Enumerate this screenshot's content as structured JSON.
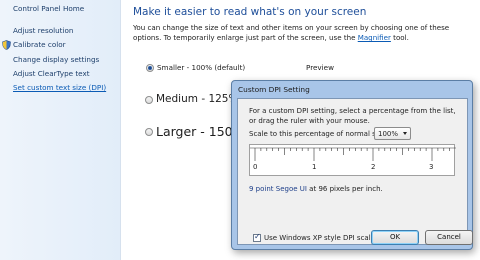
{
  "sidebar": {
    "home": "Control Panel Home",
    "links": [
      "Adjust resolution",
      "Calibrate color",
      "Change display settings",
      "Adjust ClearType text",
      "Set custom text size (DPI)"
    ]
  },
  "main": {
    "title": "Make it easier to read what's on your screen",
    "desc_before": "You can change the size of text and other items on your screen by choosing one of these options. To temporarily enlarge just part of the screen, use the ",
    "desc_link": "Magnifier",
    "desc_after": " tool.",
    "options": [
      {
        "label": "Smaller - 100% (default)",
        "selected": true
      },
      {
        "label": "Medium - 125%",
        "selected": false
      },
      {
        "label": "Larger - 150%",
        "selected": false
      }
    ],
    "preview_label": "Preview"
  },
  "dialog": {
    "title": "Custom DPI Setting",
    "description": "For a custom DPI setting, select a percentage from the list, or drag the ruler with your mouse.",
    "scale_label": "Scale to this percentage of normal size:",
    "scale_value": "100%",
    "ruler_numbers": [
      "0",
      "1",
      "2",
      "3"
    ],
    "font_info_accent": "9 point Segoe UI",
    "font_info_rest": " at 96 pixels per inch.",
    "xp_checkbox_label": "Use Windows XP style DPI scaling",
    "xp_checkbox_checked": true,
    "ok_label": "OK",
    "cancel_label": "Cancel"
  },
  "colors": {
    "link": "#0b5bb5",
    "title_blue": "#1e4e99",
    "dialog_frame": "#a8c5e8"
  }
}
